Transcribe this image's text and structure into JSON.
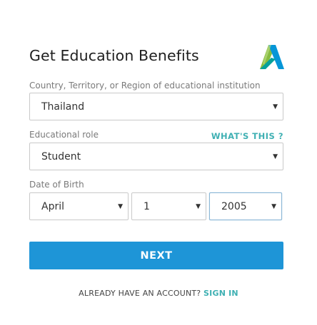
{
  "header": {
    "title": "Get Education Benefits",
    "logo_icon": "autodesk-logo",
    "logo_colors": [
      "#0696d7",
      "#87bc40",
      "#05a19b",
      "#ffffff"
    ]
  },
  "country": {
    "label": "Country, Territory, or Region of educational institution",
    "value": "Thailand"
  },
  "role": {
    "label": "Educational role",
    "whats_this": "WHAT'S THIS ?",
    "value": "Student"
  },
  "dob": {
    "label": "Date of Birth",
    "month": "April",
    "day": "1",
    "year": "2005"
  },
  "actions": {
    "next_label": "NEXT",
    "account_prompt": "ALREADY HAVE AN ACCOUNT?",
    "signin_label": "SIGN IN"
  },
  "colors": {
    "accent_blue": "#1e95d7",
    "accent_teal": "#3fb0b3"
  }
}
